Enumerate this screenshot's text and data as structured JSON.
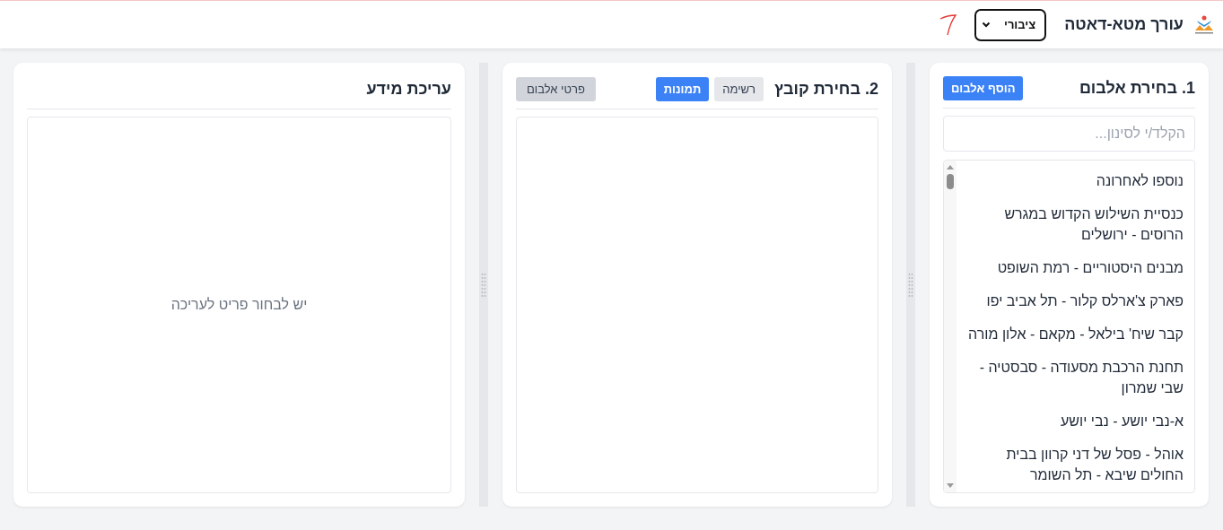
{
  "header": {
    "title": "עורך מטא-דאטה",
    "visibility_select": {
      "value": "ציבורי"
    }
  },
  "album_panel": {
    "title": "1. בחירת אלבום",
    "add_button": "הוסף אלבום",
    "filter": {
      "placeholder": "הקלד/י לסינון..."
    },
    "albums": [
      {
        "label": "נוספו לאחרונה",
        "selected": false
      },
      {
        "label": "כנסיית השילוש הקדוש במגרש הרוסים - ירושלים",
        "selected": false
      },
      {
        "label": "מבנים היסטוריים - רמת השופט",
        "selected": false
      },
      {
        "label": "פארק צ'ארלס קלור - תל אביב יפו",
        "selected": false
      },
      {
        "label": "קבר שיח' בילאל - מקאם - אלון מורה",
        "selected": false
      },
      {
        "label": "תחנת הרכבת מסעודה - סבסטיה - שבי שמרון",
        "selected": false
      },
      {
        "label": "א-נבי יושע - נבי יושע",
        "selected": false
      },
      {
        "label": "אוהל - פסל של דני קרוון בבית החולים שיבא - תל השומר",
        "selected": false
      }
    ]
  },
  "file_panel": {
    "title": "2. בחירת קובץ",
    "view_tabs": [
      {
        "label": "רשימה",
        "selected": false
      },
      {
        "label": "תמונות",
        "selected": true
      }
    ],
    "details_button": "פרטי אלבום"
  },
  "edit_panel": {
    "title": "עריכת מידע",
    "empty_message": "יש לבחור פריט לעריכה"
  }
}
